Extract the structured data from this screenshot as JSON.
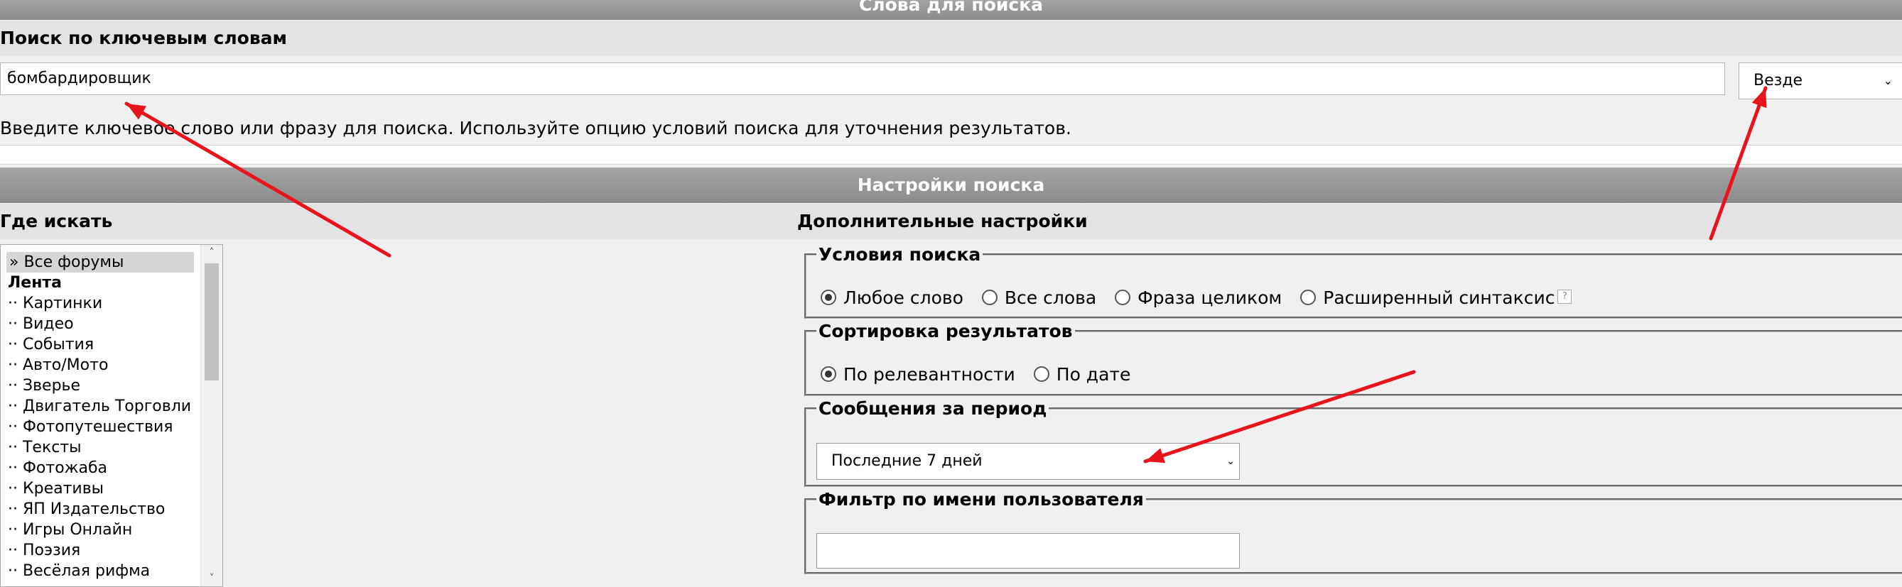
{
  "bands": {
    "search_words": "Слова для поиска",
    "search_settings": "Настройки поиска"
  },
  "keywords": {
    "heading": "Поиск по ключевым словам",
    "value": "бомбардировщик",
    "where_selected": "Везде",
    "hint": "Введите ключевое слово или фразу для поиска. Используйте опцию условий поиска для уточнения результатов."
  },
  "where": {
    "heading": "Где искать",
    "forums": [
      {
        "label": "» Все форумы",
        "style": "selected"
      },
      {
        "label": "Лента",
        "style": "bold"
      },
      {
        "label": "·· Картинки",
        "style": ""
      },
      {
        "label": "·· Видео",
        "style": ""
      },
      {
        "label": "·· События",
        "style": ""
      },
      {
        "label": "·· Авто/Мото",
        "style": ""
      },
      {
        "label": "·· Зверье",
        "style": ""
      },
      {
        "label": "·· Двигатель Торговли",
        "style": ""
      },
      {
        "label": "·· Фотопутешествия",
        "style": ""
      },
      {
        "label": "·· Тексты",
        "style": ""
      },
      {
        "label": "·· Фотожаба",
        "style": ""
      },
      {
        "label": "·· Креативы",
        "style": ""
      },
      {
        "label": "·· ЯП Издательство",
        "style": ""
      },
      {
        "label": "·· Игры Онлайн",
        "style": ""
      },
      {
        "label": "·· Поэзия",
        "style": ""
      },
      {
        "label": "·· Весёлая рифма",
        "style": ""
      }
    ]
  },
  "extra": {
    "heading": "Дополнительные настройки",
    "conditions": {
      "legend": "Условия поиска",
      "options": [
        "Любое слово",
        "Все слова",
        "Фраза целиком",
        "Расширенный синтаксис"
      ],
      "selected": 0
    },
    "sorting": {
      "legend": "Сортировка результатов",
      "options": [
        "По релевантности",
        "По дате"
      ],
      "selected": 0
    },
    "period": {
      "legend": "Сообщения за период",
      "selected": "Последние 7 дней"
    },
    "user_filter": {
      "legend": "Фильтр по имени пользователя",
      "value": ""
    }
  },
  "annotation_color": "#e8141b"
}
